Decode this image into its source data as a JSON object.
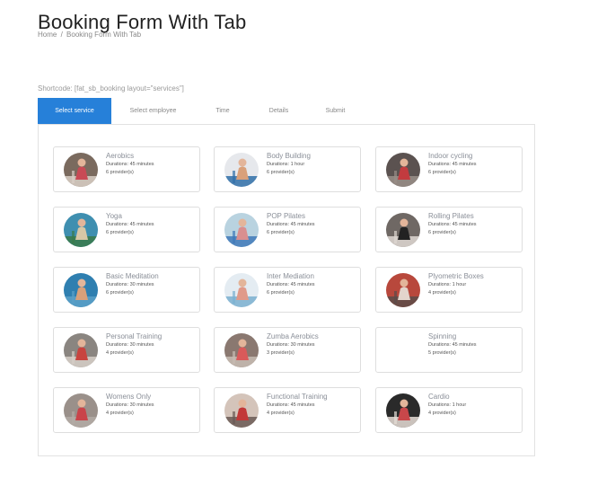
{
  "page": {
    "title": "Booking Form With Tab",
    "breadcrumb": {
      "home": "Home",
      "separator": "/",
      "current": "Booking Form With Tab"
    },
    "shortcode": "Shortcode: [fat_sb_booking layout=\"services\"]"
  },
  "tabs": [
    {
      "label": "Select service",
      "active": true
    },
    {
      "label": "Select employee",
      "active": false
    },
    {
      "label": "Time",
      "active": false
    },
    {
      "label": "Details",
      "active": false
    },
    {
      "label": "Submit",
      "active": false
    }
  ],
  "accent_color": "#2680d9",
  "services": [
    {
      "name": "Aerobics",
      "duration": "Durations: 45 minutes",
      "providers": "6 provider(s)",
      "has_image": true,
      "photo_colors": [
        "#7a6a5e",
        "#c84a55",
        "#d9cfc6"
      ]
    },
    {
      "name": "Body Building",
      "duration": "Durations: 1 hour",
      "providers": "6 provider(s)",
      "has_image": true,
      "photo_colors": [
        "#e6e8ec",
        "#d9a07a",
        "#2f6fa8"
      ]
    },
    {
      "name": "Indoor cycling",
      "duration": "Durations: 45 minutes",
      "providers": "6 provider(s)",
      "has_image": true,
      "photo_colors": [
        "#5b5250",
        "#c23b3f",
        "#9a8f88"
      ]
    },
    {
      "name": "Yoga",
      "duration": "Durations: 45 minutes",
      "providers": "6 provider(s)",
      "has_image": true,
      "photo_colors": [
        "#3f8fb0",
        "#d8c7a6",
        "#3a7a4a"
      ]
    },
    {
      "name": "POP Pilates",
      "duration": "Durations: 45 minutes",
      "providers": "6 provider(s)",
      "has_image": true,
      "photo_colors": [
        "#b9d3e0",
        "#d98f8f",
        "#3f79b8"
      ]
    },
    {
      "name": "Rolling Pilates",
      "duration": "Durations: 45 minutes",
      "providers": "6 provider(s)",
      "has_image": true,
      "photo_colors": [
        "#6f6864",
        "#222222",
        "#dfd8d2"
      ]
    },
    {
      "name": "Basic Meditation",
      "duration": "Durations: 30 minutes",
      "providers": "6 provider(s)",
      "has_image": true,
      "photo_colors": [
        "#2f7fb0",
        "#d9a07a",
        "#5aa0c8"
      ]
    },
    {
      "name": "Inter Mediation",
      "duration": "Durations: 45 minutes",
      "providers": "6 provider(s)",
      "has_image": true,
      "photo_colors": [
        "#e4ecf2",
        "#e09a8a",
        "#7bb0d0"
      ]
    },
    {
      "name": "Plyometric Boxes",
      "duration": "Durations: 1 hour",
      "providers": "4 provider(s)",
      "has_image": true,
      "photo_colors": [
        "#b8483c",
        "#e3d5cc",
        "#5a4c48"
      ]
    },
    {
      "name": "Personal Training",
      "duration": "Durations: 30 minutes",
      "providers": "4 provider(s)",
      "has_image": true,
      "photo_colors": [
        "#8a8580",
        "#c8443f",
        "#d6cfc8"
      ]
    },
    {
      "name": "Zumba Aerobics",
      "duration": "Durations: 30 minutes",
      "providers": "3 provider(s)",
      "has_image": true,
      "photo_colors": [
        "#8a7870",
        "#d95a5a",
        "#c7bcb3"
      ]
    },
    {
      "name": "Spinning",
      "duration": "Durations: 45 minutes",
      "providers": "5 provider(s)",
      "has_image": false,
      "photo_colors": []
    },
    {
      "name": "Womens Only",
      "duration": "Durations: 30 minutes",
      "providers": "4 provider(s)",
      "has_image": true,
      "photo_colors": [
        "#9a908a",
        "#c9444a",
        "#b3aba5"
      ]
    },
    {
      "name": "Functional Training",
      "duration": "Durations: 45 minutes",
      "providers": "4 provider(s)",
      "has_image": true,
      "photo_colors": [
        "#d4c4ba",
        "#c23838",
        "#6a5a55"
      ]
    },
    {
      "name": "Cardio",
      "duration": "Durations: 1 hour",
      "providers": "4 provider(s)",
      "has_image": true,
      "photo_colors": [
        "#2a2a2a",
        "#c8474a",
        "#e6ddd6"
      ]
    }
  ]
}
